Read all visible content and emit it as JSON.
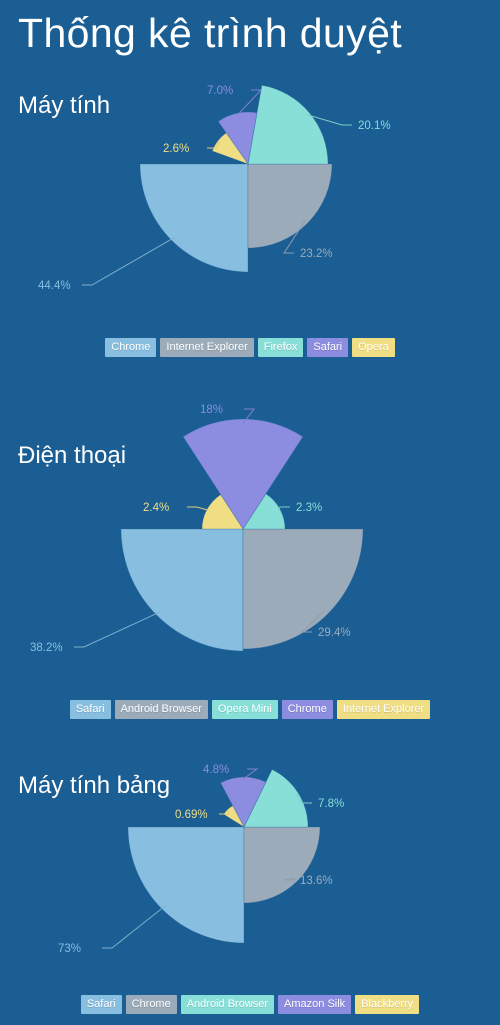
{
  "page": {
    "title": "Thống kê trình duyệt",
    "background_color": "#1a5e94",
    "text_color": "#ffffff"
  },
  "palette": {
    "chrome_blue": "#88bee0",
    "gray": "#9babba",
    "mint": "#88dfd8",
    "purple": "#8c8ce0",
    "yellow": "#f0de85"
  },
  "sections": [
    {
      "title": "Máy tính",
      "legend": [
        {
          "label": "Chrome",
          "color": "#88bee0"
        },
        {
          "label": "Internet Explorer",
          "color": "#9babba"
        },
        {
          "label": "Firefox",
          "color": "#88dfd8"
        },
        {
          "label": "Safari",
          "color": "#8c8ce0"
        },
        {
          "label": "Opera",
          "color": "#f0de85"
        }
      ]
    },
    {
      "title": "Điện thoại",
      "legend": [
        {
          "label": "Safari",
          "color": "#88bee0"
        },
        {
          "label": "Android Browser",
          "color": "#9babba"
        },
        {
          "label": "Opera Mini",
          "color": "#88dfd8"
        },
        {
          "label": "Chrome",
          "color": "#8c8ce0"
        },
        {
          "label": "Internet Explorer",
          "color": "#f0de85"
        }
      ]
    },
    {
      "title": "Máy tính bảng",
      "legend": [
        {
          "label": "Safari",
          "color": "#88bee0"
        },
        {
          "label": "Chrome",
          "color": "#9babba"
        },
        {
          "label": "Android Browser",
          "color": "#88dfd8"
        },
        {
          "label": "Amazon Silk",
          "color": "#8c8ce0"
        },
        {
          "label": "Blackberry",
          "color": "#f0de85"
        }
      ]
    }
  ],
  "chart_data": [
    {
      "type": "pie",
      "variant": "nightingale-rose",
      "title": "Máy tính",
      "categories": [
        "Chrome",
        "Internet Explorer",
        "Firefox",
        "Safari",
        "Opera"
      ],
      "values": [
        44.4,
        23.2,
        20.1,
        7.0,
        2.6
      ],
      "labels": [
        "44.4%",
        "23.2%",
        "20.1%",
        "7.0%",
        "2.6%"
      ],
      "colors": [
        "#88bee0",
        "#9babba",
        "#88dfd8",
        "#8c8ce0",
        "#f0de85"
      ],
      "center": [
        248,
        89
      ],
      "radii": [
        108,
        84,
        80,
        52,
        38
      ],
      "start_angles": [
        180,
        90,
        10,
        -35,
        -70
      ],
      "end_angles": [
        270,
        180,
        90,
        10,
        -35
      ],
      "label_positions": [
        [
          38,
          210
        ],
        [
          300,
          178
        ],
        [
          358,
          50
        ],
        [
          207,
          15
        ],
        [
          163,
          73
        ]
      ],
      "legend_position": "bottom"
    },
    {
      "type": "pie",
      "variant": "nightingale-rose",
      "title": "Điện thoại",
      "categories": [
        "Safari",
        "Android Browser",
        "Opera Mini",
        "Chrome",
        "Internet Explorer"
      ],
      "values": [
        38.2,
        29.4,
        2.3,
        18.0,
        2.4
      ],
      "labels": [
        "38.2%",
        "29.4%",
        "2.3%",
        "18%",
        "2.4%"
      ],
      "colors": [
        "#88bee0",
        "#9babba",
        "#88dfd8",
        "#8c8ce0",
        "#f0de85"
      ],
      "center": [
        243,
        139
      ],
      "radii": [
        122,
        120,
        42,
        110,
        41
      ],
      "start_angles": [
        180,
        90,
        33,
        -33,
        -90
      ],
      "end_angles": [
        270,
        180,
        90,
        33,
        -33
      ],
      "label_positions": [
        [
          30,
          257
        ],
        [
          318,
          242
        ],
        [
          296,
          117
        ],
        [
          200,
          19
        ],
        [
          143,
          117
        ]
      ],
      "legend_position": "bottom"
    },
    {
      "type": "pie",
      "variant": "nightingale-rose",
      "title": "Máy tính bảng",
      "categories": [
        "Safari",
        "Chrome",
        "Android Browser",
        "Amazon Silk",
        "Blackberry"
      ],
      "values": [
        73.0,
        13.6,
        7.8,
        4.8,
        0.69
      ],
      "labels": [
        "73%",
        "13.6%",
        "7.8%",
        "4.8%",
        "0.69%"
      ],
      "colors": [
        "#88bee0",
        "#9babba",
        "#88dfd8",
        "#8c8ce0",
        "#f0de85"
      ],
      "center": [
        244,
        67
      ],
      "radii": [
        116,
        76,
        64,
        50,
        24
      ],
      "start_angles": [
        180,
        90,
        26,
        -28,
        -58
      ],
      "end_angles": [
        270,
        180,
        90,
        26,
        -28
      ],
      "label_positions": [
        [
          58,
          188
        ],
        [
          300,
          120
        ],
        [
          318,
          43
        ],
        [
          203,
          9
        ],
        [
          175,
          54
        ]
      ],
      "legend_position": "bottom"
    }
  ]
}
